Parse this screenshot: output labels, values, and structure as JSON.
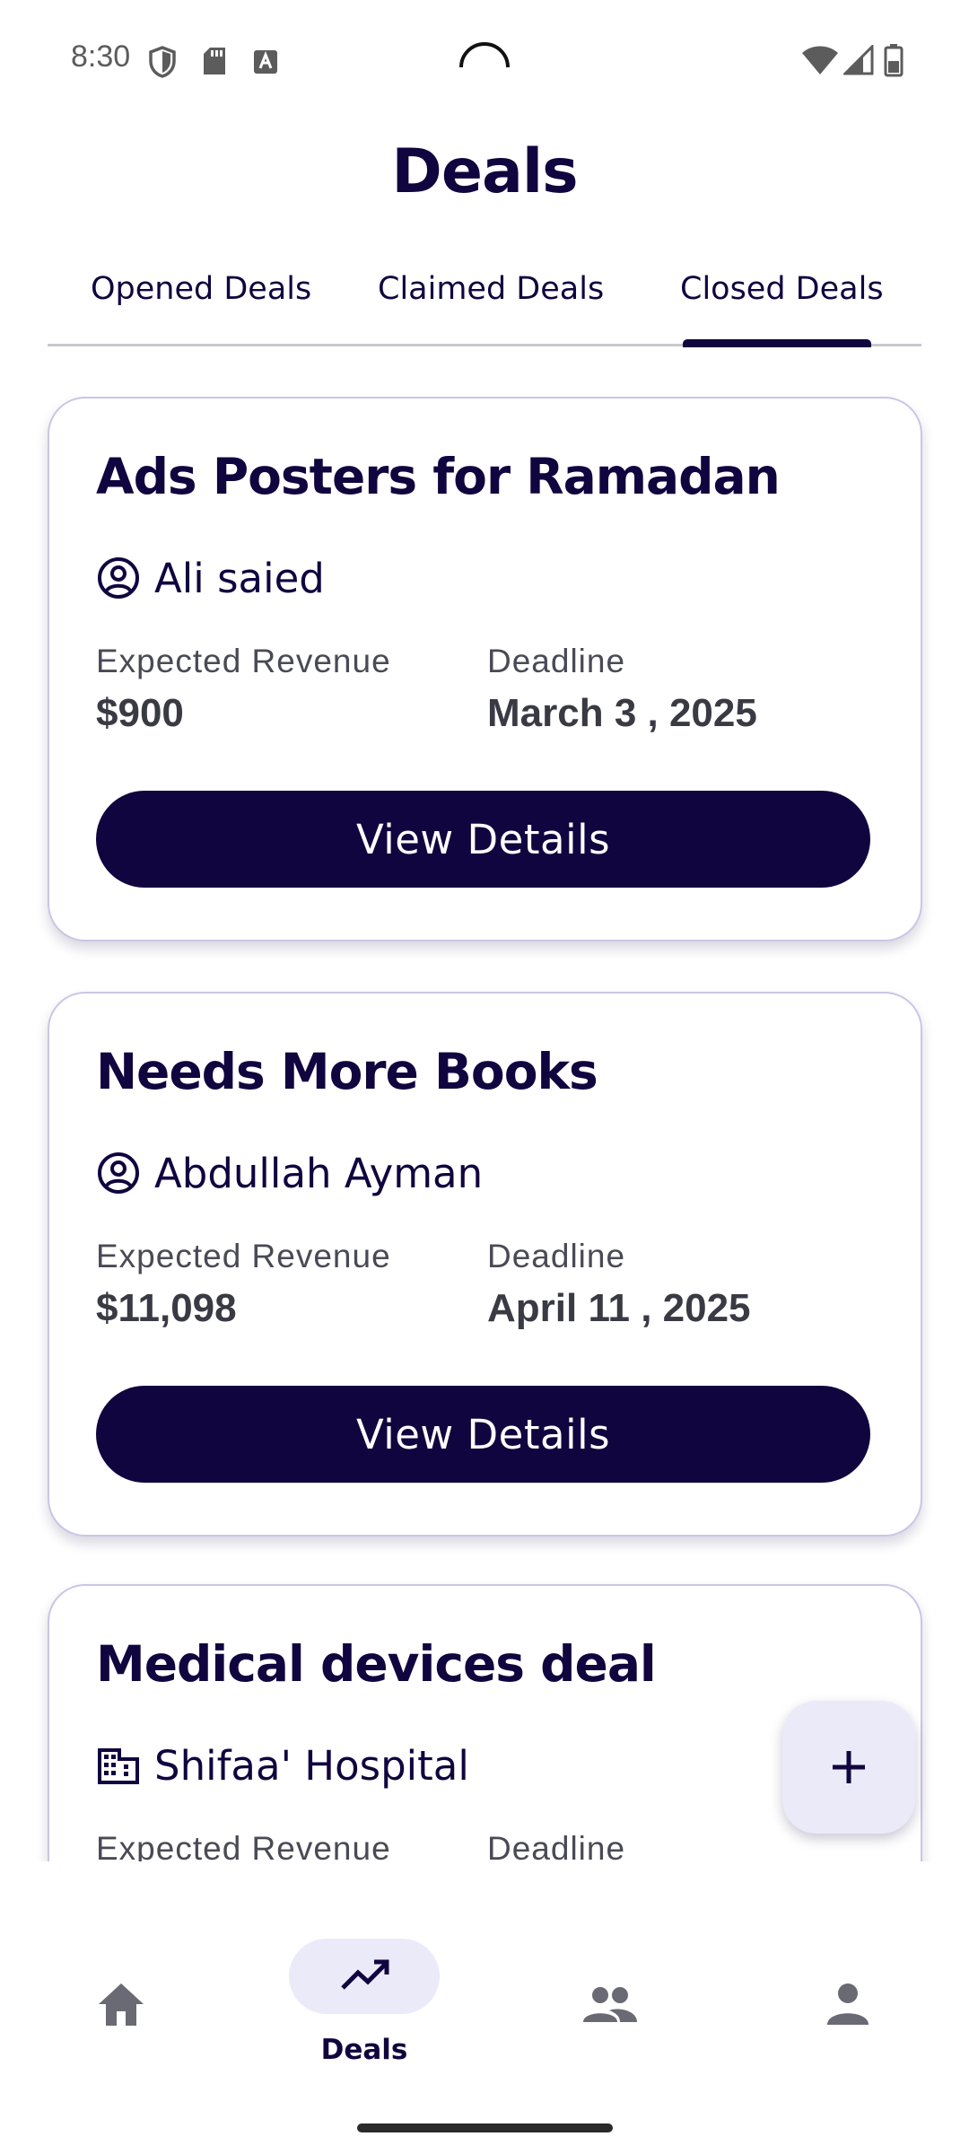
{
  "status_bar": {
    "time": "8:30",
    "left_icons": [
      "shield-icon",
      "sd-card-icon",
      "font-a-icon"
    ],
    "right_icons": [
      "wifi-icon",
      "signal-icon",
      "battery-icon"
    ]
  },
  "header": {
    "title": "Deals"
  },
  "tabs": [
    {
      "label": "Opened Deals",
      "selected": false
    },
    {
      "label": "Claimed Deals",
      "selected": false
    },
    {
      "label": "Closed Deals",
      "selected": true
    }
  ],
  "deals": [
    {
      "title": "Ads Posters for Ramadan",
      "owner_icon": "person-circle-icon",
      "owner": "Ali saied",
      "revenue_label": "Expected Revenue",
      "revenue": "$900",
      "deadline_label": "Deadline",
      "deadline": "March 3 , 2025",
      "button": "View Details"
    },
    {
      "title": "Needs More Books",
      "owner_icon": "person-circle-icon",
      "owner": "Abdullah Ayman",
      "revenue_label": "Expected Revenue",
      "revenue": "$11,098",
      "deadline_label": "Deadline",
      "deadline": "April 11 , 2025",
      "button": "View Details"
    },
    {
      "title": "Medical devices deal",
      "owner_icon": "building-icon",
      "owner": "Shifaa' Hospital",
      "revenue_label": "Expected Revenue",
      "deadline_label": "Deadline"
    }
  ],
  "fab": {
    "icon": "plus-icon"
  },
  "bottom_nav": {
    "items": [
      {
        "icon": "home-icon",
        "label": ""
      },
      {
        "icon": "trending-up-icon",
        "label": "Deals",
        "selected": true
      },
      {
        "icon": "people-icon",
        "label": ""
      },
      {
        "icon": "person-icon",
        "label": ""
      }
    ]
  },
  "colors": {
    "primary": "#11053f",
    "pill": "#ebeaf9",
    "card_border": "#c9c6e6",
    "muted_text": "#4a4a55"
  }
}
